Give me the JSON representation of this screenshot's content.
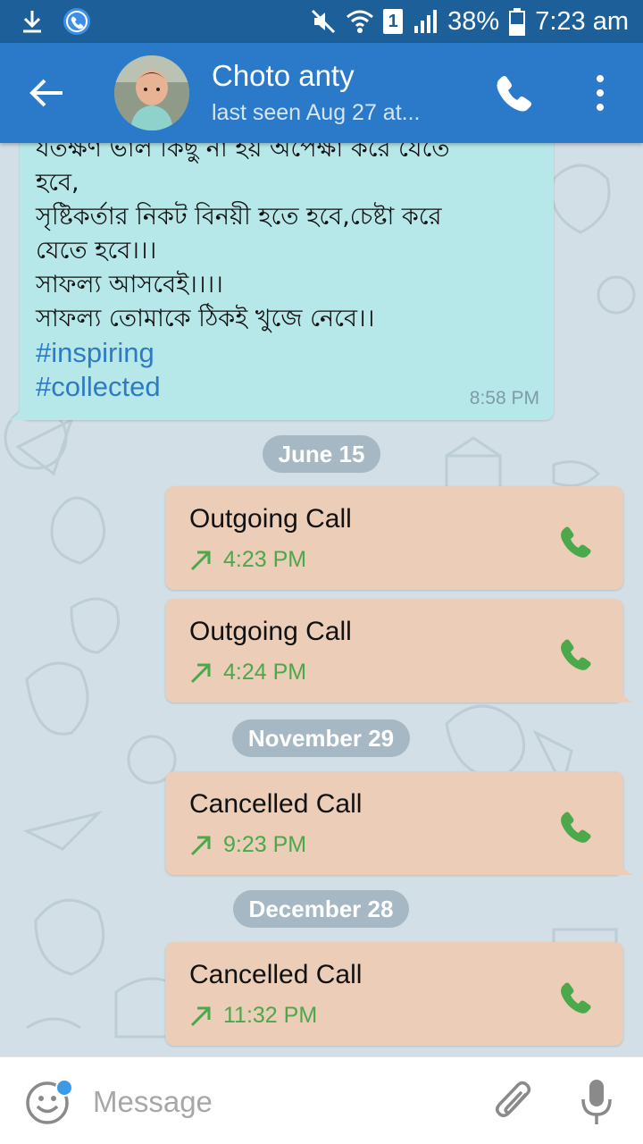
{
  "status_bar": {
    "sim_label": "1",
    "battery": "38%",
    "time": "7:23 am"
  },
  "header": {
    "title": "Choto anty",
    "subtitle": "last seen Aug 27 at..."
  },
  "messages": {
    "incoming": {
      "lines": [
        "যতক্ষণ ভাল কিছু না হয় অপেক্ষা করে যেতে",
        "হবে,",
        "সৃষ্টিকর্তার নিকট বিনয়ী হতে হবে,চেষ্টা করে",
        "যেতে হবে।।।",
        "সাফল্য আসবেই।।।।",
        "সাফল্য তোমাকে ঠিকই খুজে নেবে।।"
      ],
      "hashtags": [
        "#inspiring",
        "#collected"
      ],
      "time": "8:58 PM"
    },
    "date_separators": [
      "June 15",
      "November 29",
      "December 28"
    ],
    "calls": [
      {
        "title": "Outgoing Call",
        "time": "4:23 PM"
      },
      {
        "title": "Outgoing Call",
        "time": "4:24 PM"
      },
      {
        "title": "Cancelled Call",
        "time": "9:23 PM"
      },
      {
        "title": "Cancelled Call",
        "time": "11:32 PM"
      }
    ]
  },
  "input": {
    "placeholder": "Message"
  },
  "colors": {
    "status_bar": "#1d5f99",
    "app_bar": "#2b7ac9",
    "incoming_bubble": "#b6e8ea",
    "call_bubble": "#ebcdb8",
    "call_green": "#4ba84b",
    "hashtag": "#2f7bc3"
  },
  "icons": {
    "status_left": [
      "download-icon",
      "viber-icon"
    ],
    "status_right": [
      "mute-icon",
      "wifi-icon",
      "sim-icon",
      "signal-icon",
      "battery-icon"
    ],
    "app_bar": [
      "back-arrow-icon",
      "phone-icon",
      "more-vert-icon"
    ],
    "input_bar": [
      "emoji-icon",
      "attach-icon",
      "mic-icon"
    ]
  }
}
